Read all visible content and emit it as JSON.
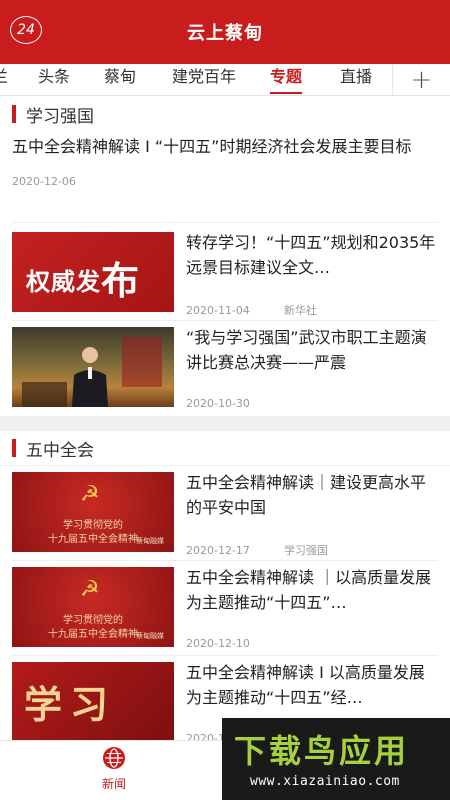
{
  "header": {
    "badge": "24",
    "title": "云上蔡甸"
  },
  "tabs": [
    {
      "label": "兰"
    },
    {
      "label": "头条"
    },
    {
      "label": "蔡甸"
    },
    {
      "label": "建党百年"
    },
    {
      "label": "专题",
      "active": true
    },
    {
      "label": "直播"
    }
  ],
  "tabs_add_label": "+",
  "sections": [
    {
      "title": "学习强国",
      "text_item": {
        "title": "五中全会精神解读 I “十四五”时期经济社会发展主要目标",
        "date": "2020-12-06"
      },
      "items": [
        {
          "title": "转存学习！“十四五”规划和2035年远景目标建议全文…",
          "date": "2020-11-04",
          "source": "新华社",
          "thumb_text": "权威发",
          "thumb_big": "布"
        },
        {
          "title": "“我与学习强国”武汉市职工主题演讲比赛总决赛——严震",
          "date": "2020-10-30",
          "source": ""
        }
      ]
    },
    {
      "title": "五中全会",
      "items": [
        {
          "title": "五中全会精神解读｜建设更高水平的平安中国",
          "date": "2020-12-17",
          "source": "学习强国",
          "thumb_l1": "学习贯彻党的",
          "thumb_l2": "十九届五中全会精神",
          "thumb_wm": "蔡甸融媒"
        },
        {
          "title": "五中全会精神解读 ｜以高质量发展为主题推动“十四五”…",
          "date": "2020-12-10",
          "source": "",
          "thumb_l1": "学习贯彻党的",
          "thumb_l2": "十九届五中全会精神",
          "thumb_wm": "蔡甸融媒"
        },
        {
          "title": "五中全会精神解读 I 以高质量发展为主题推动“十四五”经…",
          "date": "2020-1",
          "source": "",
          "thumb_text": "学习"
        }
      ]
    }
  ],
  "bottom_nav": {
    "news_label": "新闻"
  },
  "watermark": {
    "title": "下载鸟应用",
    "url": "www.xiazainiao.com"
  },
  "colors": {
    "brand_red": "#c91d1d",
    "watermark_green": "#a6d13c"
  }
}
